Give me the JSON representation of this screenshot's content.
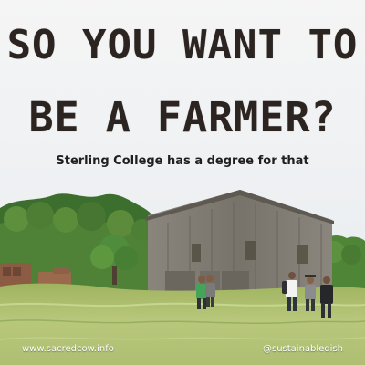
{
  "headline": {
    "line1": "SO YOU WANT TO",
    "line2": "BE A FARMER?"
  },
  "subtitle": "Sterling College has a degree for that",
  "footer": {
    "website": "www.sacredcow.info",
    "handle": "@sustainabledish"
  },
  "colors": {
    "headline_text": "#2b2420",
    "sky_top": "#f4f4f4",
    "sky_bottom": "#e6ecf2",
    "barn": "#7f7a70",
    "field": "#a9bd6a"
  }
}
